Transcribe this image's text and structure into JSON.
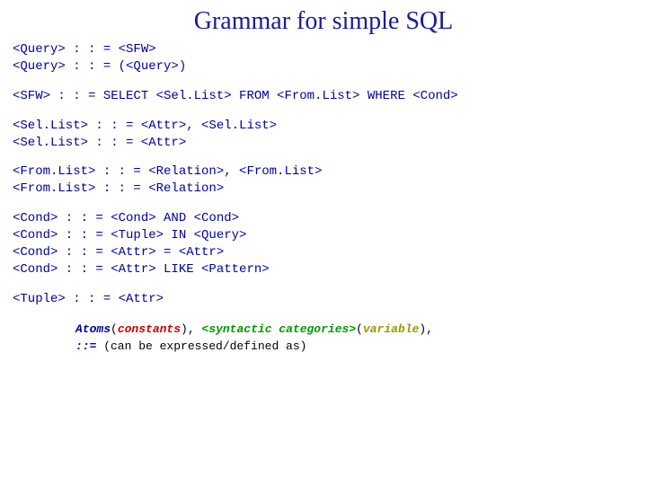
{
  "title": "Grammar for simple SQL",
  "rules": {
    "r1a": "<Query> : : = <SFW>",
    "r1b": "<Query> : : = (<Query>)",
    "r2": "<SFW> : : = SELECT <Sel.List> FROM <From.List> WHERE <Cond>",
    "r3a": "<Sel.List> : : = <Attr>, <Sel.List>",
    "r3b": "<Sel.List> : : = <Attr>",
    "r4a": "<From.List> : : = <Relation>, <From.List>",
    "r4b": "<From.List> : : = <Relation>",
    "r5a": "<Cond> : : = <Cond> AND <Cond>",
    "r5b": "<Cond> : : = <Tuple> IN <Query>",
    "r5c": "<Cond> : : = <Attr> = <Attr>",
    "r5d": "<Cond> : : = <Attr> LIKE <Pattern>",
    "r6": "<Tuple> : : = <Attr>"
  },
  "legend": {
    "atoms": "Atoms",
    "lp1": "(",
    "constants": "constants",
    "rp1": ")",
    "sep1": ", ",
    "lt": "<",
    "syncat": "syntactic categories",
    "gt": ">",
    "lp2": "(",
    "variable": "variable",
    "rp2": ")",
    "comma2": ",",
    "defop": "::=",
    "tail": " (can be expressed/defined as)"
  }
}
